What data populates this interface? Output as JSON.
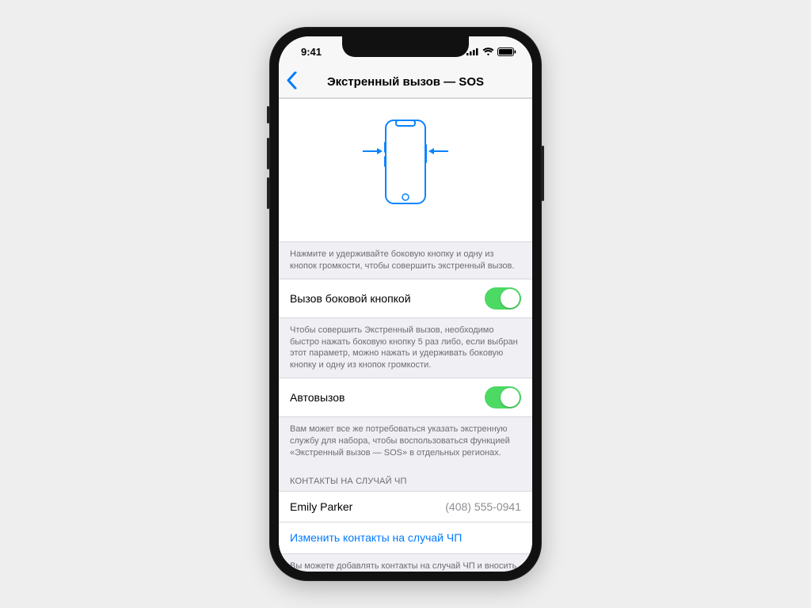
{
  "status": {
    "time": "9:41"
  },
  "nav": {
    "title": "Экстренный вызов — SOS"
  },
  "hero_footer": "Нажмите и удерживайте боковую кнопку и одну из кнопок громкости, чтобы совершить экстренный вызов.",
  "side_button": {
    "label": "Вызов боковой кнопкой",
    "on": true,
    "footer": "Чтобы совершить Экстренный вызов, необходимо быстро нажать боковую кнопку 5 раз либо, если выбран этот параметр, можно нажать и удерживать боковую кнопку и одну из кнопок громкости."
  },
  "auto_call": {
    "label": "Автовызов",
    "on": true,
    "footer": "Вам может все же потребоваться указать экстренную службу для набора, чтобы воспользоваться функцией «Экстренный вызов — SOS» в отдельных регионах."
  },
  "contacts": {
    "header": "КОНТАКТЫ НА СЛУЧАЙ ЧП",
    "items": [
      {
        "name": "Emily Parker",
        "phone": "(408) 555-0941"
      }
    ],
    "edit_label": "Изменить контакты на случай ЧП",
    "footer": "Вы можете добавлять контакты на случай ЧП и вносить в них изменения для функции «Экстренный"
  }
}
